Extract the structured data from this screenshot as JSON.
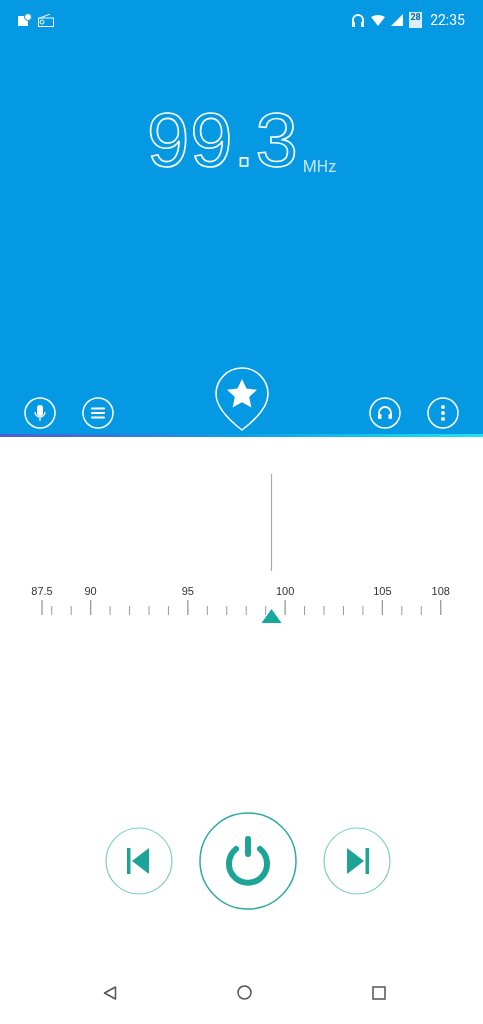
{
  "status_bar": {
    "time": "22:35",
    "battery": "28"
  },
  "station": {
    "frequency": "99.3",
    "unit": "MHz"
  },
  "dial": {
    "labels": [
      "87.5",
      "90",
      "95",
      "100",
      "105",
      "108"
    ]
  }
}
